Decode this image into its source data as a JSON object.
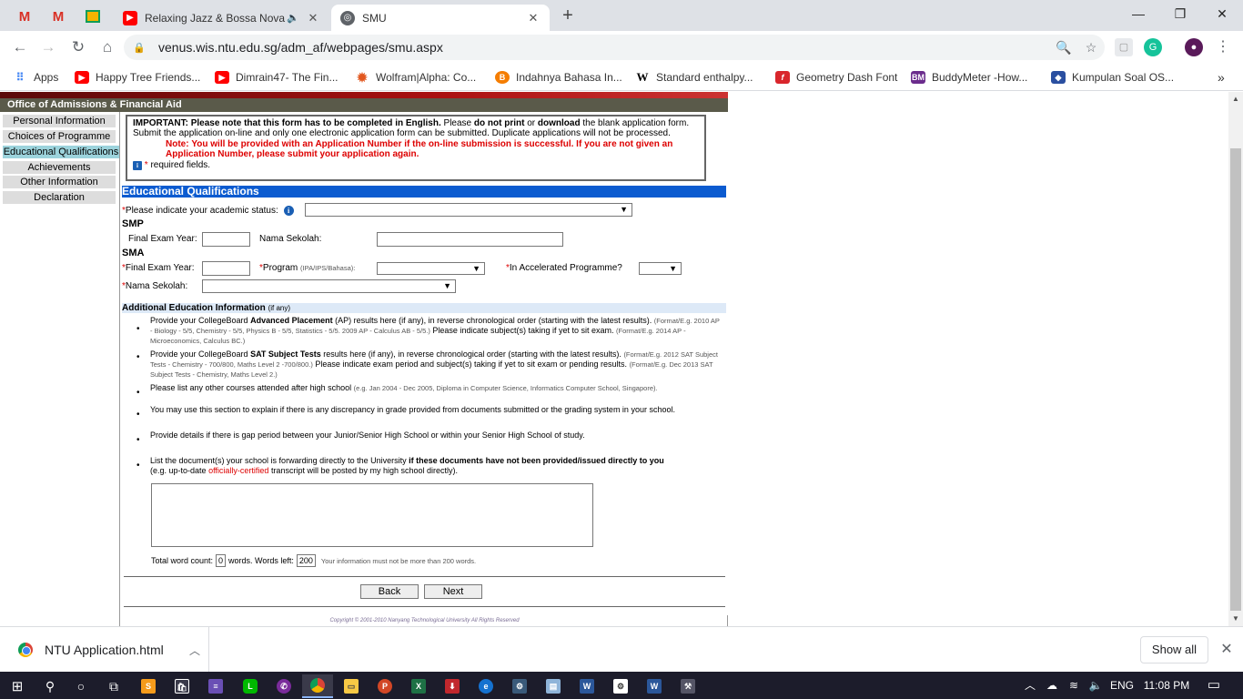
{
  "browser": {
    "tabs": [
      {
        "title": "Relaxing Jazz & Bossa Nova",
        "audio": "speaker-icon"
      },
      {
        "title": "SMU"
      }
    ],
    "url": "venus.wis.ntu.edu.sg/adm_af/webpages/smu.aspx",
    "bookmarks": [
      {
        "label": "Apps"
      },
      {
        "label": "Happy Tree Friends..."
      },
      {
        "label": "Dimrain47- The Fin..."
      },
      {
        "label": "Wolfram|Alpha: Co..."
      },
      {
        "label": "Indahnya Bahasa In..."
      },
      {
        "label": "Standard enthalpy..."
      },
      {
        "label": "Geometry Dash Font"
      },
      {
        "label": "BuddyMeter -How..."
      },
      {
        "label": "Kumpulan Soal OS..."
      }
    ],
    "bookmarks_more": "»"
  },
  "page": {
    "office_title": "Office of Admissions & Financial Aid",
    "sidebar": [
      "Personal Information",
      "Choices of Programme",
      "Educational Qualifications",
      "Achievements",
      "Other Information",
      "Declaration"
    ],
    "notice": {
      "important_label": "IMPORTANT:",
      "important_p1": "Please note that this form has to be completed in English.",
      "important_p2": "Please",
      "do_not_print": "do not print",
      "or": "or",
      "download": "download",
      "important_p3": "the blank application form. Submit the application on-line and only one electronic application form can be submitted. Duplicate applications will not be processed.",
      "note_label": "Note:",
      "note_text": "You will be provided with an Application Number if the on-line submission is successful. If you are not given an Application Number, please submit your application again.",
      "required_text": "required fields."
    },
    "section_title": "Educational Qualifications",
    "academic_status_label": "Please indicate your academic status:",
    "smp_label": "SMP",
    "final_exam_year_label": "Final Exam Year:",
    "nama_sekolah_label": "Nama Sekolah:",
    "sma_label": "SMA",
    "program_label": "Program",
    "program_hint": "(IPA/IPS/Bahasa):",
    "accelerated_label": "In Accelerated Programme?",
    "additional_title": "Additional Education Information",
    "additional_hint": "(if any)",
    "bullets": {
      "b1_a": "Provide your CollegeBoard",
      "b1_b": "Advanced Placement",
      "b1_c": "(AP) results here (if any), in reverse chronological order (starting with the latest results).",
      "b1_fmt1": "(Format/E.g. 2010 AP - Biology - 5/5, Chemistry - 5/5, Physics B - 5/5, Statistics - 5/5. 2009 AP - Calculus AB - 5/5.)",
      "b1_d": "Please indicate subject(s) taking if yet to sit exam.",
      "b1_fmt2": "(Format/E.g. 2014 AP - Microeconomics, Calculus BC.)",
      "b2_a": "Provide your CollegeBoard",
      "b2_b": "SAT Subject Tests",
      "b2_c": "results here (if any), in reverse chronological order (starting with the latest results).",
      "b2_fmt1": "(Format/E.g. 2012 SAT Subject Tests - Chemistry - 700/800, Maths Level 2 -700/800.)",
      "b2_d": "Please indicate exam period and subject(s) taking if yet to sit exam or pending results.",
      "b2_fmt2": "(Format/E.g. Dec 2013 SAT Subject Tests - Chemistry, Maths Level 2.)",
      "b3_a": "Please list any other courses attended after high school",
      "b3_fmt": "(e.g. Jan 2004 - Dec 2005, Diploma in Computer Science, Informatics Computer School, Singapore).",
      "b4": "You may use this section to explain if there is any discrepancy in grade provided from documents submitted or the grading system in your school.",
      "b5": "Provide details if there is gap period between your Junior/Senior High School or within your Senior High School of study.",
      "b6_a": "List the document(s) your school is forwarding directly to the University",
      "b6_b": "if these documents have not been provided/issued directly to you",
      "b6_c": "(e.g. up-to-date",
      "b6_d": "officially-certified",
      "b6_e": "transcript will be posted by my high school directly)."
    },
    "word_count": {
      "label_total": "Total word count:",
      "total": "0",
      "label_words": "words. Words left:",
      "left": "200",
      "hint": "Your information must not be more than 200 words."
    },
    "back_label": "Back",
    "next_label": "Next",
    "copyright": "Copyright © 2001-2010 Nanyang Technological University All Rights Reserved"
  },
  "downloads": {
    "file": "NTU Application.html",
    "show_all": "Show all"
  },
  "taskbar": {
    "lang": "ENG",
    "time": "11:08 PM"
  }
}
